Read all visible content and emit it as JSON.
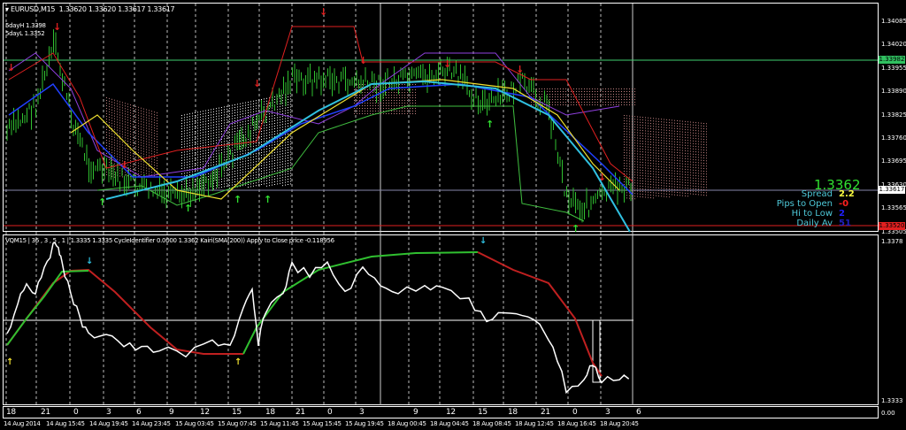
{
  "main_chart": {
    "title": "EURUSD,M15",
    "ohlc": "1.33620 1.33620 1.33617 1.33617",
    "five_day_high": "5dayH 1.3398",
    "five_day_low": "5dayL 1.3352",
    "current_price": "1.3362",
    "info": [
      {
        "label": "Spread",
        "value": "2.2",
        "color": "#ffff40"
      },
      {
        "label": "Pips to Open",
        "value": "-0",
        "color": "#ff2020"
      },
      {
        "label": "Hi to Low",
        "value": "2",
        "color": "#2020ff"
      },
      {
        "label": "Daily Av",
        "value": "51",
        "color": "#2020c0"
      }
    ],
    "price_axis": [
      "1.34085",
      "1.34020",
      "1.33955",
      "1.33890",
      "1.33825",
      "1.33760",
      "1.33695",
      "1.33630",
      "1.33565",
      "1.33505"
    ],
    "high_tag": "1.33982",
    "bid_tag": "1.33617",
    "low_tag": "1.33520"
  },
  "sub_chart": {
    "title": "VQM15 | 36 , 3 , 5 , 1 | 1.3335 1.3335 CycleIdentifier 0.0000 1.3362 Kairi(SMA(200)) Apply to Close price -0.118956",
    "axis_top": "1.3378",
    "axis_bottom": "1.3333",
    "axis_zero": "0.00"
  },
  "time_axis": {
    "hours": [
      "18",
      "21",
      "0",
      "3",
      "6",
      "9",
      "12",
      "15",
      "18",
      "21",
      "0",
      "3",
      "9",
      "12",
      "15",
      "18",
      "21",
      "0",
      "3",
      "6"
    ],
    "dates": [
      "14 Aug 2014",
      "14 Aug 15:45",
      "14 Aug 19:45",
      "14 Aug 23:45",
      "15 Aug 03:45",
      "15 Aug 07:45",
      "15 Aug 11:45",
      "15 Aug 15:45",
      "15 Aug 19:45",
      "18 Aug 00:45",
      "18 Aug 04:45",
      "18 Aug 08:45",
      "18 Aug 12:45",
      "18 Aug 16:45",
      "18 Aug 20:45"
    ]
  }
}
